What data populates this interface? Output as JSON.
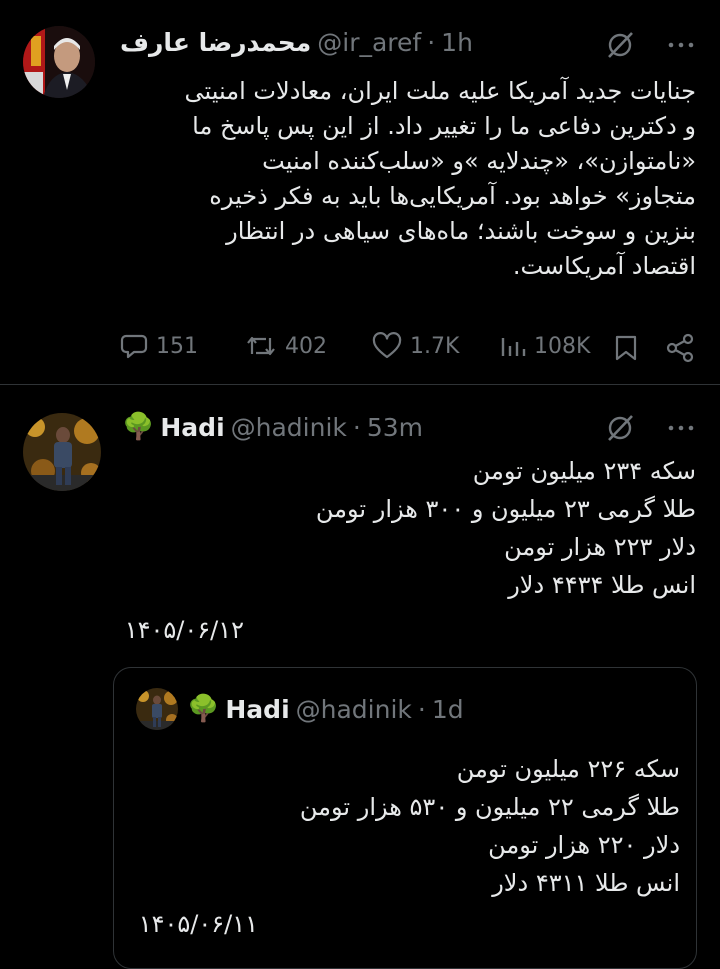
{
  "post1": {
    "author_name": "محمدرضا عارف",
    "handle": "@ir_aref",
    "separator": "·",
    "time": "1h",
    "lines": [
      "جنایات جدید آمریکا علیه ملت ایران، معادلات امنیتی",
      "و دکترین دفاعی ما را تغییر داد. از این پس پاسخ ما",
      "«نامتوازن»، «چندلایه »و «سلب‌کننده امنیت",
      "متجاوز» خواهد بود. آمریکایی‌ها باید به فکر ذخیره",
      "بنزین و سوخت باشند؛ ماه‌های سیاهی در انتظار",
      "اقتصاد آمریکاست."
    ],
    "stats": {
      "replies": "151",
      "reposts": "402",
      "likes": "1.7K",
      "views": "108K"
    }
  },
  "post2": {
    "emoji": "🌳",
    "author_name": "Hadi",
    "handle": "@hadinik",
    "separator": "·",
    "time": "53m",
    "lines": [
      "سکه ۲۳۴ میلیون تومن",
      "طلا گرمی ۲۳ میلیون و ۳۰۰ هزار تومن",
      "دلار ۲۲۳ هزار تومن",
      "انس طلا ۴۴۳۴ دلار"
    ],
    "date": "۱۴۰۵/۰۶/۱۲"
  },
  "quote": {
    "emoji": "🌳",
    "author_name": "Hadi",
    "handle": "@hadinik",
    "separator": "·",
    "time": "1d",
    "lines": [
      "سکه ۲۲۶ میلیون تومن",
      "طلا گرمی ۲۲ میلیون و ۵۳۰ هزار تومن",
      "دلار ۲۲۰ هزار تومن",
      "انس طلا ۴۳۱۱ دلار"
    ],
    "date": "۱۴۰۵/۰۶/۱۱"
  },
  "icons": {
    "grok": "slashed-circle-icon",
    "more": "more-icon",
    "reply": "reply-icon",
    "repost": "repost-icon",
    "like": "like-icon",
    "views": "views-icon",
    "bookmark": "bookmark-icon",
    "share": "share-icon"
  },
  "colors": {
    "background": "#000000",
    "text": "#e7e9ea",
    "muted": "#71767b",
    "border": "#2f3336"
  }
}
